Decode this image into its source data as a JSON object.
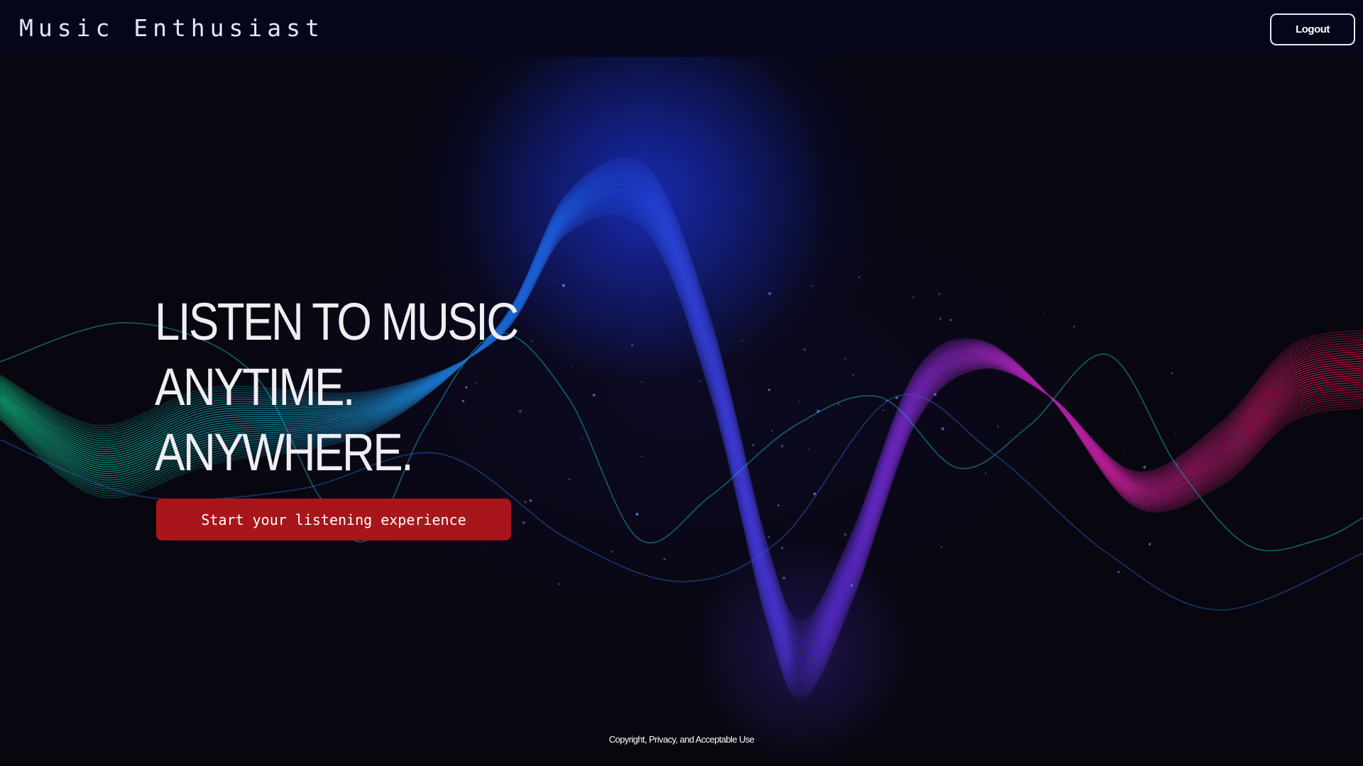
{
  "header": {
    "brand": "Music Enthusiast",
    "logout_label": "Logout"
  },
  "hero": {
    "headline_lines": [
      "LISTEN TO MUSIC",
      "ANYTIME.",
      "ANYWHERE."
    ],
    "cta_label": "Start your listening experience"
  },
  "footer": {
    "link_label": "Copyright, Privacy, and Acceptable Use"
  },
  "colors": {
    "background": "#08070f",
    "topbar": "#05061a",
    "cta": "#a8161b",
    "wave_green": "#10b07a",
    "wave_blue": "#1c4de0",
    "wave_purple": "#8a22c8",
    "wave_magenta": "#c41a8a",
    "wave_red": "#d8174a"
  },
  "background_image": "sound-wave-graphic"
}
